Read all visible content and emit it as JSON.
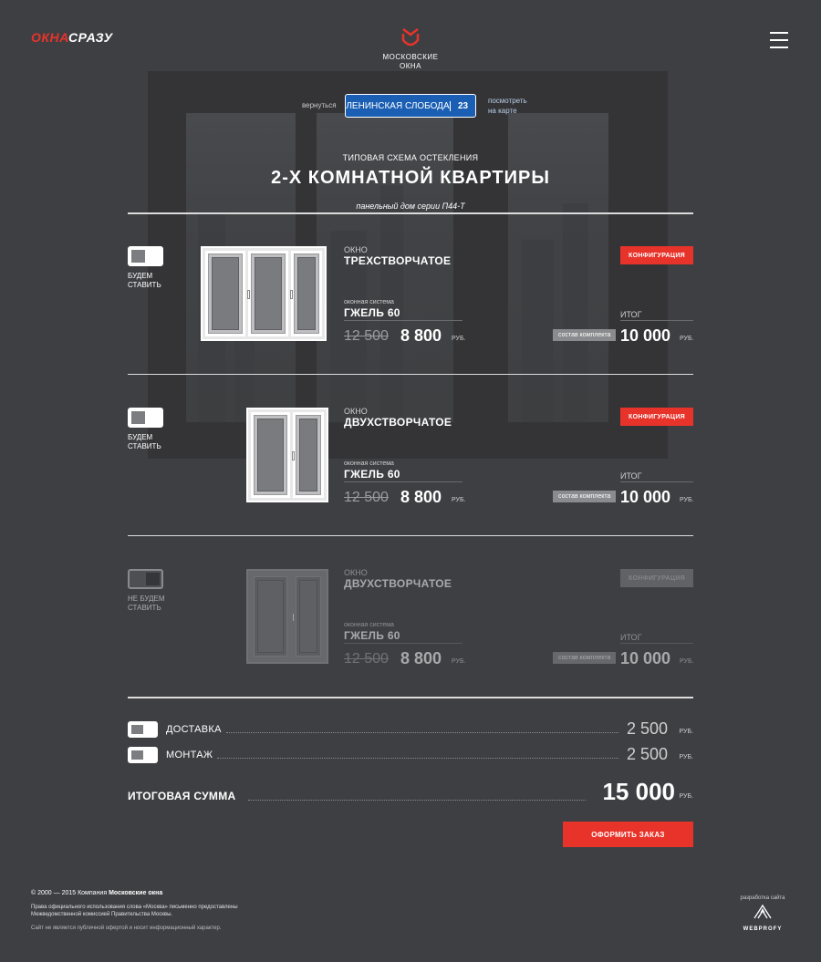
{
  "header": {
    "brand_left_red": "ОКНА",
    "brand_left_white": "СРАЗУ",
    "center_logo_line1": "МОСКОВСКИЕ",
    "center_logo_line2": "ОКНА"
  },
  "nav": {
    "back": "вернуться",
    "district": "ЛЕНИНСКАЯ СЛОБОДА",
    "district_num": "23",
    "map_line1": "посмотреть",
    "map_line2": "на карте"
  },
  "title": {
    "subtitle": "ТИПОВАЯ СХЕМА ОСТЕКЛЕНИЯ",
    "main": "2-Х КОМНАТНОЙ КВАРТИРЫ",
    "series": "панельный дом серии П44-Т"
  },
  "items": [
    {
      "toggle_label": "БУДЕМ СТАВИТЬ",
      "type_small": "ОКНО",
      "type_big": "ТРЕХСТВОРЧАТОЕ",
      "config": "КОНФИГУРАЦИЯ",
      "system_small": "оконная система",
      "system_big": "ГЖЕЛЬ 60",
      "old_price": "12 500",
      "new_price": "8 800",
      "rub": "РУБ.",
      "kit": "состав комплекта",
      "total_small": "ИТОГ",
      "total": "10 000",
      "total_rub": "РУБ."
    },
    {
      "toggle_label": "БУДЕМ СТАВИТЬ",
      "type_small": "ОКНО",
      "type_big": "ДВУХСТВОРЧАТОЕ",
      "config": "КОНФИГУРАЦИЯ",
      "system_small": "оконная система",
      "system_big": "ГЖЕЛЬ 60",
      "old_price": "12 500",
      "new_price": "8 800",
      "rub": "РУБ.",
      "kit": "состав комплекта",
      "total_small": "ИТОГ",
      "total": "10 000",
      "total_rub": "РУБ."
    },
    {
      "toggle_label": "НЕ БУДЕМ СТАВИТЬ",
      "type_small": "ОКНО",
      "type_big": "ДВУХСТВОРЧАТОЕ",
      "config": "КОНФИГУРАЦИЯ",
      "system_small": "оконная система",
      "system_big": "ГЖЕЛЬ 60",
      "old_price": "12 500",
      "new_price": "8 800",
      "rub": "РУБ.",
      "kit": "состав комплекта",
      "total_small": "ИТОГ",
      "total": "10 000",
      "total_rub": "РУБ."
    }
  ],
  "extras": [
    {
      "label": "ДОСТАВКА",
      "price": "2 500",
      "rub": "РУБ."
    },
    {
      "label": "МОНТАЖ",
      "price": "2 500",
      "rub": "РУБ."
    }
  ],
  "summary": {
    "label": "ИТОГОВАЯ СУММА",
    "price": "15 000",
    "rub": "РУБ.",
    "order": "ОФОРМИТЬ ЗАКАЗ"
  },
  "footer": {
    "copy_prefix": "© 2000 — 2015 Компания ",
    "copy_company": "Московские окна",
    "rights_line1": "Права официального использования слова «Москва» письменно предоставлены",
    "rights_line2": "Межведомственной комиссией Правительства Москвы.",
    "note": "Сайт не является публичной офертой и носит информационный характер.",
    "dev_label": "разработка сайта",
    "dev_name": "WEBPROFY"
  },
  "colors": {
    "background": "#3e3f43",
    "accent": "#e8332a",
    "sign_blue": "#1a5fb4"
  }
}
